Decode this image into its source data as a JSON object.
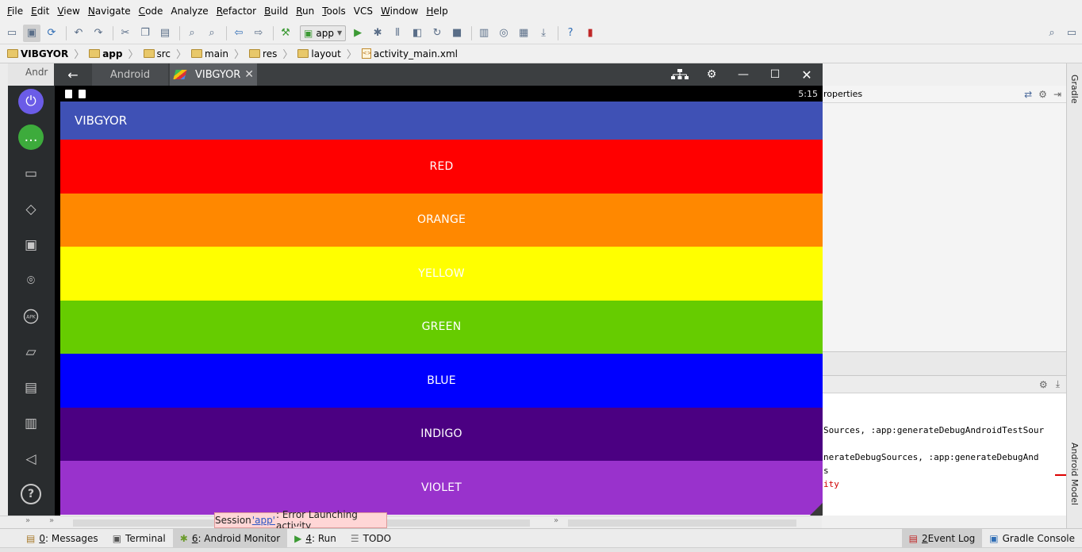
{
  "menu": [
    {
      "label": "File",
      "u": "F",
      "rest": "ile"
    },
    {
      "label": "Edit",
      "u": "E",
      "rest": "dit"
    },
    {
      "label": "View",
      "u": "V",
      "rest": "iew"
    },
    {
      "label": "Navigate",
      "u": "N",
      "rest": "avigate"
    },
    {
      "label": "Code",
      "u": "C",
      "rest": "ode"
    },
    {
      "label": "Analyze",
      "u": "",
      "rest": "Analyze"
    },
    {
      "label": "Refactor",
      "u": "R",
      "rest": "efactor"
    },
    {
      "label": "Build",
      "u": "B",
      "rest": "uild"
    },
    {
      "label": "Run",
      "u": "R",
      "rest": "un"
    },
    {
      "label": "Tools",
      "u": "T",
      "rest": "ools"
    },
    {
      "label": "VCS",
      "u": "",
      "rest": "VCS"
    },
    {
      "label": "Window",
      "u": "W",
      "rest": "indow"
    },
    {
      "label": "Help",
      "u": "H",
      "rest": "elp"
    }
  ],
  "toolbar": {
    "run_config": "app"
  },
  "breadcrumbs": [
    "VIBGYOR",
    "app",
    "src",
    "main",
    "res",
    "layout",
    "activity_main.xml"
  ],
  "ide": {
    "behind_tab": "Andr",
    "properties_header": "roperties",
    "right_strip_top": "Gradle",
    "right_strip_bottom": "Android Model",
    "run_lines": [
      {
        "text": "Sources, :app:generateDebugAndroidTestSour",
        "error": false
      },
      {
        "text": "",
        "error": false
      },
      {
        "text": "nerateDebugSources, :app:generateDebugAnd",
        "error": false
      },
      {
        "text": "s",
        "error": false
      },
      {
        "text": "ity",
        "error": true
      }
    ]
  },
  "emulator": {
    "tabs": [
      "Android",
      "VIBGYOR"
    ],
    "status_time": "5:15",
    "app_title": "VIBGYOR",
    "stripes": [
      {
        "label": "RED",
        "color": "#ff0000"
      },
      {
        "label": "ORANGE",
        "color": "#ff8800"
      },
      {
        "label": "YELLOW",
        "color": "#ffff00"
      },
      {
        "label": "GREEN",
        "color": "#66cc00"
      },
      {
        "label": "BLUE",
        "color": "#0000ff"
      },
      {
        "label": "INDIGO",
        "color": "#4b0082"
      },
      {
        "label": "VIOLET",
        "color": "#9932cc"
      }
    ]
  },
  "toast": {
    "prefix": "Session ",
    "link": "'app'",
    "suffix": ": Error Launching activity"
  },
  "bottom_tools": [
    {
      "num": "0",
      "label": ": Messages",
      "icon": "messages-icon"
    },
    {
      "num": "",
      "label": "Terminal",
      "icon": "terminal-icon"
    },
    {
      "num": "6",
      "label": ": Android Monitor",
      "icon": "android-icon"
    },
    {
      "num": "4",
      "label": ": Run",
      "icon": "run-icon"
    },
    {
      "num": "",
      "label": "TODO",
      "icon": "todo-icon"
    }
  ],
  "bottom_right_tools": [
    {
      "num": "2",
      "label": "Event Log",
      "icon": "event-log-icon"
    },
    {
      "num": "",
      "label": "Gradle Console",
      "icon": "gradle-console-icon"
    }
  ]
}
